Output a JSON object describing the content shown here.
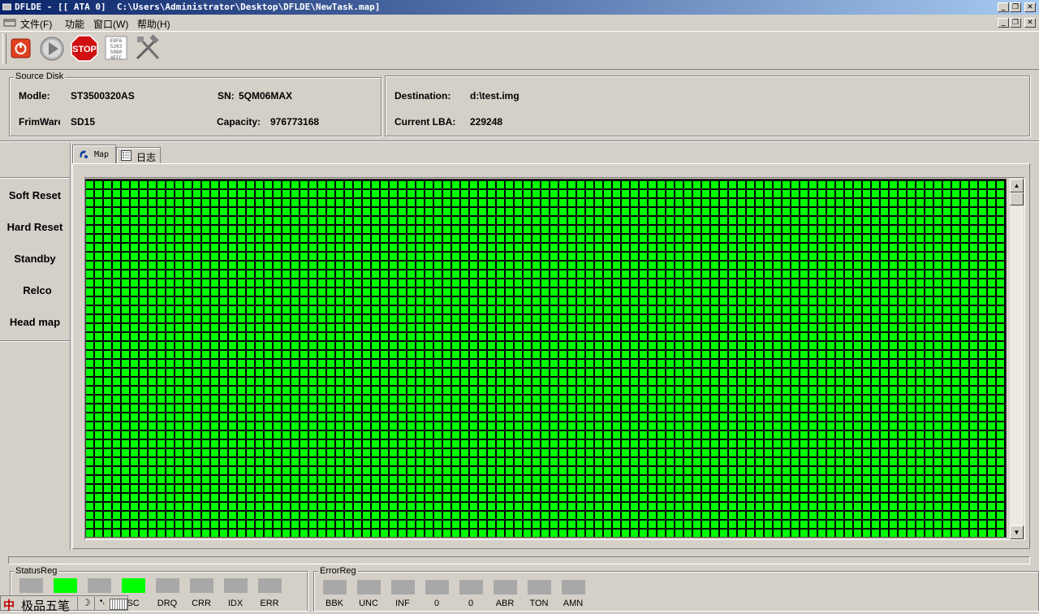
{
  "window": {
    "title": "DFLDE - [[ ATA 0]  C:\\Users\\Administrator\\Desktop\\DFLDE\\NewTask.map]"
  },
  "menu": [
    "文件(F)",
    "功能",
    "窗口(W)",
    "帮助(H)"
  ],
  "toolbar": {
    "icons": [
      "power-icon",
      "play-icon",
      "stop-icon",
      "hex-view-icon",
      "tools-icon"
    ],
    "stop_label": "STOP",
    "hex_lines": [
      "E8F6",
      "5203",
      "5080",
      "4EFC"
    ]
  },
  "source": {
    "group_label": "Source Disk",
    "model_label": "Modle:",
    "model_value": "ST3500320AS",
    "sn_label": "SN:",
    "sn_value": "5QM06MAX",
    "firmware_label": "FrimWare",
    "firmware_value": "SD15",
    "capacity_label": "Capacity:",
    "capacity_value": "976773168"
  },
  "destination": {
    "dest_label": "Destination:",
    "dest_value": "d:\\test.img",
    "lba_label": "Current LBA:",
    "lba_value": "229248"
  },
  "side_buttons": [
    "Soft Reset",
    "Hard Reset",
    "Standby",
    "Relco",
    "Head map"
  ],
  "tabs": [
    {
      "label": "Map",
      "icon": "map-icon"
    },
    {
      "label": "日志",
      "icon": "log-icon"
    }
  ],
  "map": {
    "cell_color": "#00ff00",
    "status": "all-good"
  },
  "status_reg": {
    "label": "StatusReg",
    "items": [
      {
        "label": "",
        "on": false
      },
      {
        "label": "",
        "on": true
      },
      {
        "label": "",
        "on": false
      },
      {
        "label": "SC",
        "on": true
      },
      {
        "label": "DRQ",
        "on": false
      },
      {
        "label": "CRR",
        "on": false
      },
      {
        "label": "IDX",
        "on": false
      },
      {
        "label": "ERR",
        "on": false
      }
    ]
  },
  "error_reg": {
    "label": "ErrorReg",
    "items": [
      {
        "label": "BBK"
      },
      {
        "label": "UNC"
      },
      {
        "label": "INF"
      },
      {
        "label": "0"
      },
      {
        "label": "0"
      },
      {
        "label": "ABR"
      },
      {
        "label": "TON"
      },
      {
        "label": "AMN"
      }
    ]
  },
  "ime": {
    "label": "极品五笔",
    "logo": "中"
  }
}
